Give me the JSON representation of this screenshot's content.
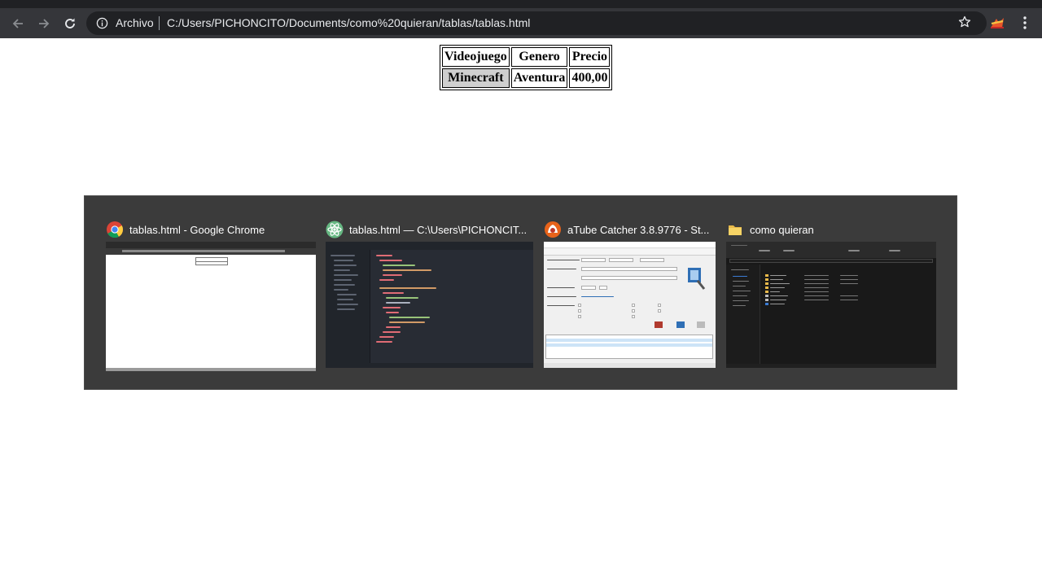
{
  "browser": {
    "scheme_label": "Archivo",
    "url": "C:/Users/PICHONCITO/Documents/como%20quieran/tablas/tablas.html",
    "icons": {
      "back": "arrow-left-icon",
      "forward": "arrow-right-icon",
      "reload": "reload-icon",
      "site_info": "info-icon",
      "bookmark": "star-icon",
      "extension": "extension-icon",
      "menu": "kebab-menu-icon"
    }
  },
  "page_table": {
    "headers": [
      "Videojuego",
      "Genero",
      "Precio"
    ],
    "rows": [
      [
        "Minecraft",
        "Aventura",
        "400,00"
      ]
    ]
  },
  "switcher": {
    "windows": [
      {
        "title": "tablas.html - Google Chrome",
        "icon": "chrome-icon"
      },
      {
        "title": "tablas.html — C:\\Users\\PICHONCIT...",
        "icon": "atom-icon"
      },
      {
        "title": "aTube Catcher 3.8.9776 - St...",
        "icon": "atube-catcher-icon"
      },
      {
        "title": "como quieran",
        "icon": "folder-icon"
      }
    ]
  },
  "colors": {
    "toolbar": "#35363a",
    "omnibox": "#202124",
    "switcher_bg": "#3b3b3b",
    "table_selection": "#cfcfcf"
  }
}
